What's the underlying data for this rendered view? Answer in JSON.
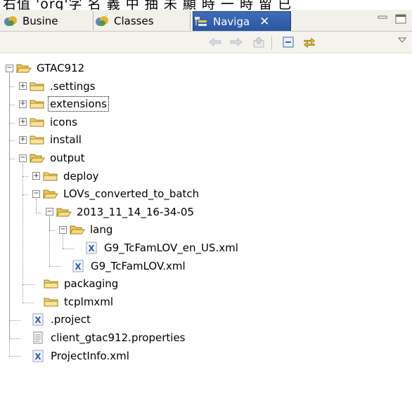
{
  "caption_text": "右值 'org'字 名 義 中 抽 未 顯 時 一 時 留 已",
  "tabs": [
    {
      "label": "Busine",
      "icon": "business-objects-icon",
      "active": false
    },
    {
      "label": "Classes",
      "icon": "classes-icon",
      "active": false
    },
    {
      "label": "Naviga",
      "icon": "navigator-icon",
      "active": true
    }
  ],
  "tree": [
    {
      "label": "GTAC912",
      "type": "folder-open",
      "expander": "minus",
      "depth": 0
    },
    {
      "label": ".settings",
      "type": "folder",
      "expander": "plus",
      "depth": 1
    },
    {
      "label": "extensions",
      "type": "folder",
      "expander": "plus",
      "depth": 1,
      "selected": true
    },
    {
      "label": "icons",
      "type": "folder",
      "expander": "plus",
      "depth": 1
    },
    {
      "label": "install",
      "type": "folder",
      "expander": "plus",
      "depth": 1
    },
    {
      "label": "output",
      "type": "folder-open",
      "expander": "minus",
      "depth": 1
    },
    {
      "label": "deploy",
      "type": "folder",
      "expander": "plus",
      "depth": 2
    },
    {
      "label": "LOVs_converted_to_batch",
      "type": "folder-open",
      "expander": "minus",
      "depth": 2
    },
    {
      "label": "2013_11_14_16-34-05",
      "type": "folder-open",
      "expander": "minus",
      "depth": 3
    },
    {
      "label": "lang",
      "type": "folder-open",
      "expander": "minus",
      "depth": 4
    },
    {
      "label": "G9_TcFamLOV_en_US.xml",
      "type": "xml",
      "expander": "none",
      "depth": 5
    },
    {
      "label": "G9_TcFamLOV.xml",
      "type": "xml",
      "expander": "none",
      "depth": 4
    },
    {
      "label": "packaging",
      "type": "folder",
      "expander": "none",
      "depth": 2
    },
    {
      "label": "tcplmxml",
      "type": "folder",
      "expander": "none",
      "depth": 2
    },
    {
      "label": ".project",
      "type": "xml",
      "expander": "none",
      "depth": 1
    },
    {
      "label": "client_gtac912.properties",
      "type": "text",
      "expander": "none",
      "depth": 1
    },
    {
      "label": "ProjectInfo.xml",
      "type": "xml",
      "expander": "none",
      "depth": 1
    }
  ],
  "toolbar_icons": [
    "back-arrow-icon",
    "forward-arrow-icon",
    "go-up-icon",
    "collapse-all-icon",
    "link-with-editor-icon",
    "view-menu-icon"
  ],
  "colors": {
    "active_tab": "#2f5ea9",
    "folder": "#f6d36a",
    "xml_icon": "#2e5bb0"
  }
}
